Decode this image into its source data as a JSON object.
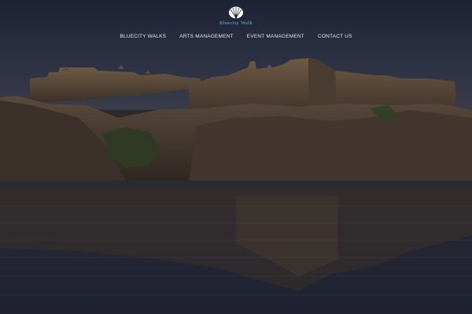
{
  "brand": {
    "name": "Bluecity Walk",
    "logo_icon": "peacock-icon",
    "accent_color": "#5bc0de"
  },
  "nav": {
    "items": [
      {
        "label": "BLUECITY WALKS"
      },
      {
        "label": "ARTS MANAGEMENT"
      },
      {
        "label": "EVENT MANAGEMENT"
      },
      {
        "label": "CONTACT US"
      }
    ]
  }
}
